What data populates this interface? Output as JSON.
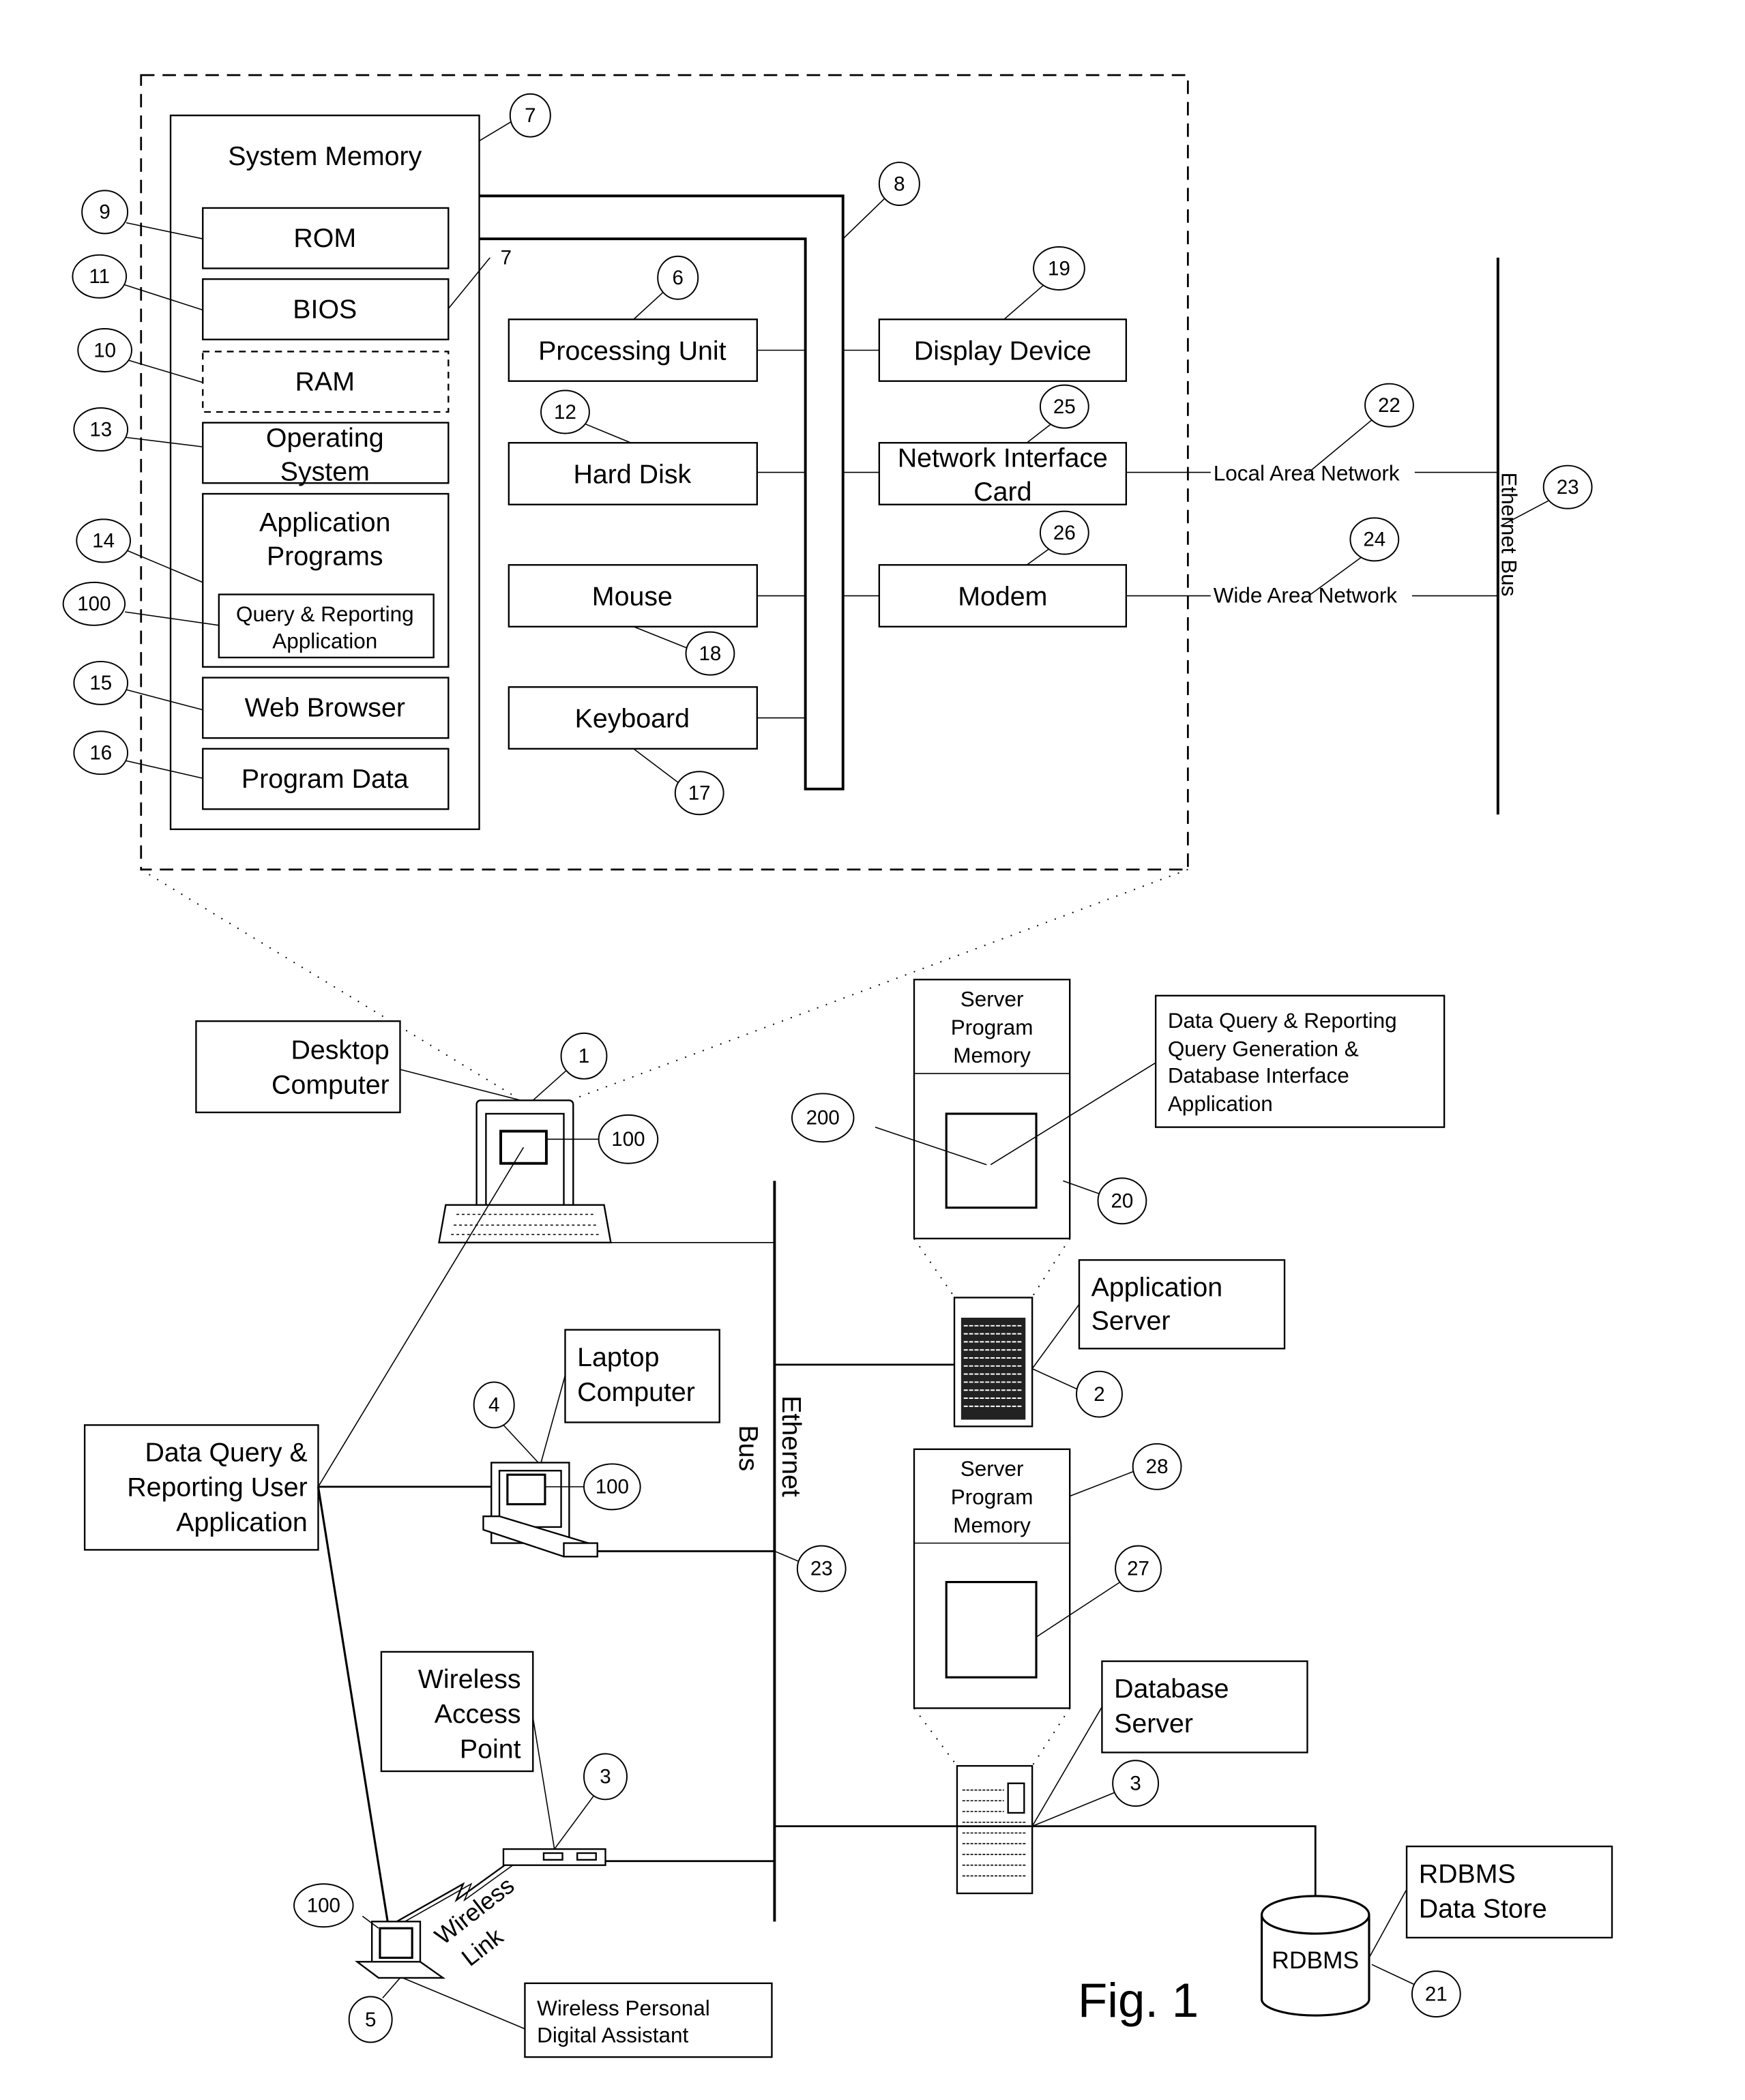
{
  "figure_label": "Fig. 1",
  "system": {
    "memory_title": "System Memory",
    "memory_items": [
      "ROM",
      "BIOS",
      "RAM",
      "Operating System",
      "Application Programs",
      "Web Browser",
      "Program Data"
    ],
    "os_line1": "Operating",
    "os_line2": "System",
    "app_line1": "Application",
    "app_line2": "Programs",
    "qr_line1": "Query & Reporting",
    "qr_line2": "Application",
    "devices": [
      "Processing Unit",
      "Hard Disk",
      "Mouse",
      "Keyboard"
    ],
    "peripherals": {
      "display": "Display Device",
      "nic_line1": "Network Interface",
      "nic_line2": "Card",
      "modem": "Modem"
    },
    "networks": {
      "lan": "Local Area Network",
      "wan": "Wide Area Network",
      "bus": "Ethernet Bus"
    }
  },
  "network": {
    "desktop": [
      "Desktop",
      "Computer"
    ],
    "laptop": [
      "Laptop",
      "Computer"
    ],
    "user_app": [
      "Data Query &",
      "Reporting User",
      "Application"
    ],
    "wap": [
      "Wireless",
      "Access",
      "Point"
    ],
    "wireless_link": [
      "Wireless",
      "Link"
    ],
    "pda": [
      "Wireless Personal",
      "Digital Assistant"
    ],
    "ethernet_bus": [
      "Ethernet",
      "Bus"
    ],
    "server_mem": [
      "Server",
      "Program",
      "Memory"
    ],
    "dq_app": [
      "Data Query & Reporting",
      "Query Generation &",
      "Database Interface",
      "Application"
    ],
    "app_server": [
      "Application",
      "Server"
    ],
    "db_server": [
      "Database",
      "Server"
    ],
    "rdbms_store": [
      "RDBMS",
      "Data Store"
    ],
    "rdbms": "RDBMS"
  },
  "refs": {
    "r7a": "7",
    "r7b": "7",
    "r8": "8",
    "r9": "9",
    "r11": "11",
    "r10": "10",
    "r13": "13",
    "r14": "14",
    "r100a": "100",
    "r15": "15",
    "r16": "16",
    "r6": "6",
    "r12": "12",
    "r18": "18",
    "r17": "17",
    "r19": "19",
    "r25": "25",
    "r26": "26",
    "r22": "22",
    "r24": "24",
    "r23a": "23",
    "r1": "1",
    "r100b": "100",
    "r200": "200",
    "r20": "20",
    "r2": "2",
    "r4": "4",
    "r100c": "100",
    "r23b": "23",
    "r28": "28",
    "r27": "27",
    "r3a": "3",
    "r3b": "3",
    "r100d": "100",
    "r5": "5",
    "r21": "21"
  }
}
